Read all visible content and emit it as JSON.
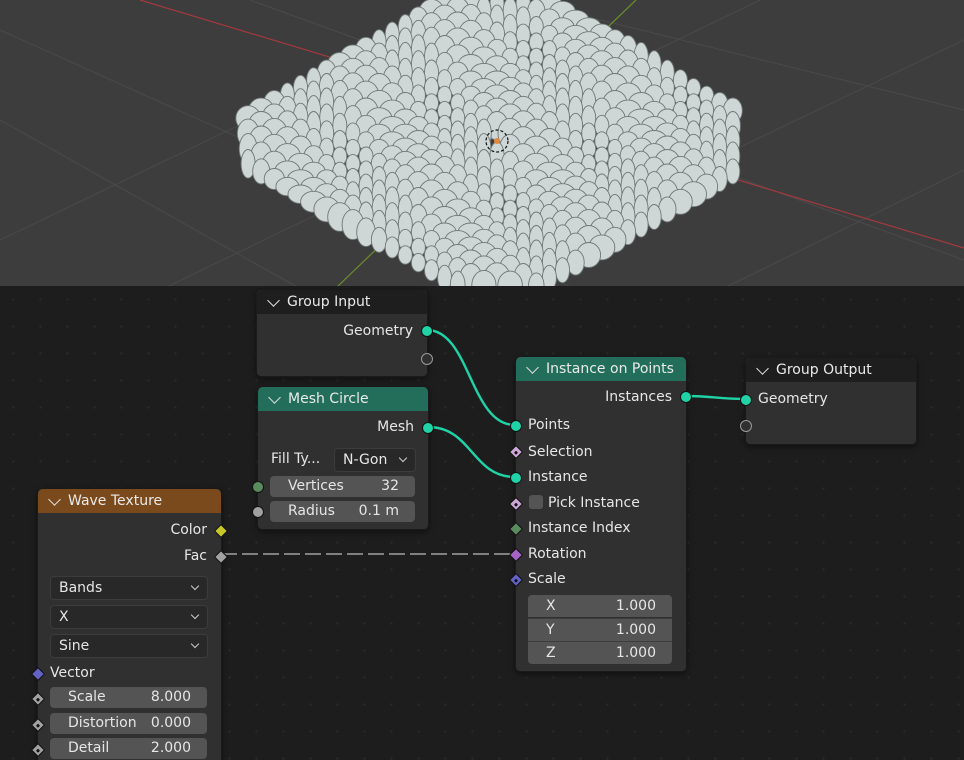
{
  "viewport": {
    "disc_color": "#cfd6d6",
    "x_axis_color": "#a3393e",
    "y_axis_color": "#6a8e2c",
    "grid_color": "#4a4a4a"
  },
  "nodes": {
    "group_input": {
      "title": "Group Input",
      "outputs": [
        "Geometry"
      ]
    },
    "mesh_circle": {
      "title": "Mesh Circle",
      "output": "Mesh",
      "fill_type_label": "Fill Ty...",
      "fill_type_value": "N-Gon",
      "vertices_label": "Vertices",
      "vertices_value": "32",
      "radius_label": "Radius",
      "radius_value": "0.1 m"
    },
    "instance_on_points": {
      "title": "Instance on Points",
      "output": "Instances",
      "inputs": [
        "Points",
        "Selection",
        "Instance",
        "Pick Instance",
        "Instance Index",
        "Rotation",
        "Scale"
      ],
      "scale": [
        {
          "axis": "X",
          "value": "1.000"
        },
        {
          "axis": "Y",
          "value": "1.000"
        },
        {
          "axis": "Z",
          "value": "1.000"
        }
      ]
    },
    "group_output": {
      "title": "Group Output",
      "input": "Geometry"
    },
    "wave_texture": {
      "title": "Wave Texture",
      "outputs": [
        "Color",
        "Fac"
      ],
      "dropdowns": [
        "Bands",
        "X",
        "Sine"
      ],
      "vector_label": "Vector",
      "fields": [
        {
          "label": "Scale",
          "value": "8.000"
        },
        {
          "label": "Distortion",
          "value": "0.000"
        },
        {
          "label": "Detail",
          "value": "2.000"
        }
      ]
    }
  },
  "colors": {
    "geometry_socket": "#1fd3a6",
    "float_socket": "#a1a1a1",
    "color_socket": "#c7c729",
    "vector_socket": "#6363c7",
    "bool_socket": "#cca6d6",
    "int_socket": "#598c5c",
    "rotation_socket": "#a663c7",
    "link_color": "#1fd3a6"
  }
}
